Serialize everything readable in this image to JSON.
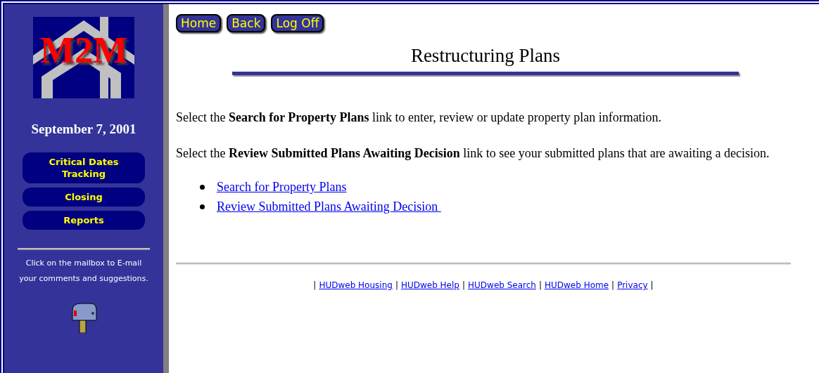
{
  "sidebar": {
    "logo": {
      "text": "M2M"
    },
    "date": "September 7, 2001",
    "nav": [
      {
        "label": "Critical Dates Tracking"
      },
      {
        "label": "Closing"
      },
      {
        "label": "Reports"
      }
    ],
    "mail_note": "Click on the mailbox to E-mail your comments and suggestions."
  },
  "toolbar": [
    "Home",
    "Back",
    "Log Off"
  ],
  "title": "Restructuring Plans",
  "paragraphs": [
    "Select the **Search for Property Plans** link to enter, review or update property plan information.",
    "Select the **Review Submitted Plans Awaiting Decision** link to see your submitted plans that are awaiting a decision."
  ],
  "links": [
    "Search for Property Plans",
    "Review Submitted Plans Awaiting Decision "
  ],
  "footer": [
    {
      "kind": "separator",
      "text": "|"
    },
    {
      "kind": "link",
      "text": "HUDweb Housing"
    },
    {
      "kind": "separator",
      "text": "|"
    },
    {
      "kind": "link",
      "text": "HUDweb Help"
    },
    {
      "kind": "separator",
      "text": "|"
    },
    {
      "kind": "link",
      "text": "HUDweb Search"
    },
    {
      "kind": "separator",
      "text": "|"
    },
    {
      "kind": "link",
      "text": "HUDweb Home"
    },
    {
      "kind": "separator",
      "text": "|"
    },
    {
      "kind": "link",
      "text": "Privacy"
    },
    {
      "kind": "separator",
      "text": "|"
    }
  ]
}
